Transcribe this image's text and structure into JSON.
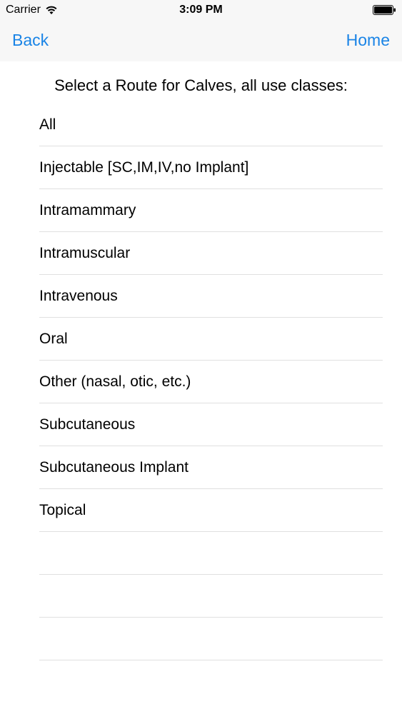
{
  "status_bar": {
    "carrier": "Carrier",
    "time": "3:09 PM",
    "wifi_icon": "wifi-icon",
    "battery_icon": "battery-icon"
  },
  "nav": {
    "back_label": "Back",
    "home_label": "Home",
    "accent_color": "#1a84e6"
  },
  "page": {
    "title": "Select a Route for Calves, all use classes:"
  },
  "routes": [
    "All",
    "Injectable [SC,IM,IV,no Implant]",
    "Intramammary",
    "Intramuscular",
    "Intravenous",
    "Oral",
    "Other (nasal, otic, etc.)",
    "Subcutaneous",
    "Subcutaneous Implant",
    "Topical"
  ]
}
